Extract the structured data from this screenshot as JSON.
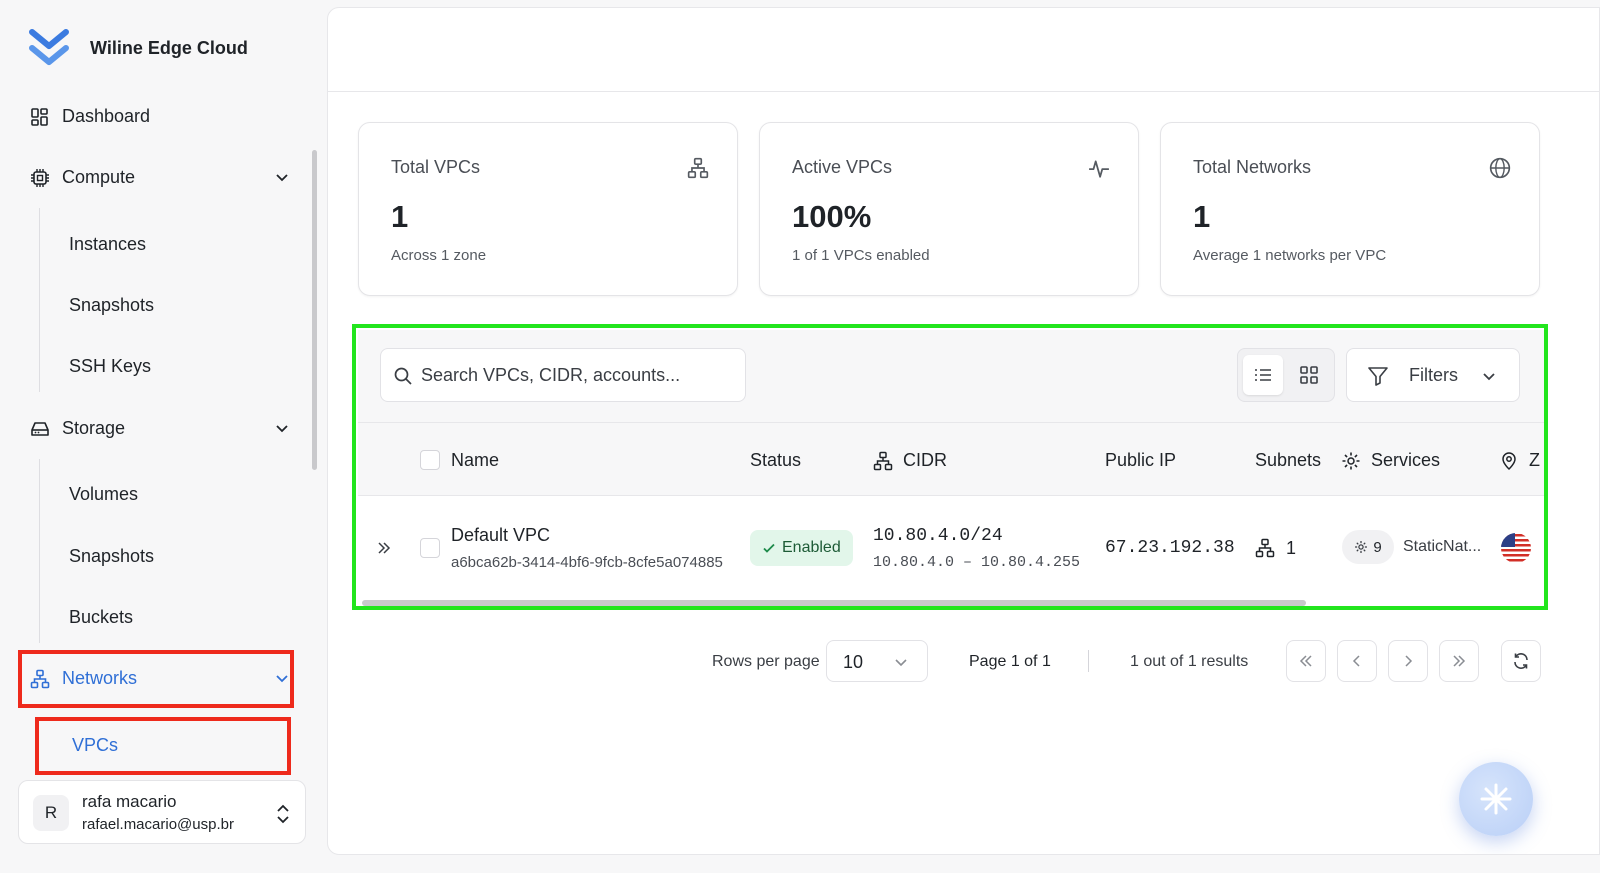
{
  "brand": {
    "name": "Wiline Edge Cloud"
  },
  "sidebar": {
    "dashboard": "Dashboard",
    "compute": {
      "label": "Compute",
      "items": [
        "Instances",
        "Snapshots",
        "SSH Keys"
      ]
    },
    "storage": {
      "label": "Storage",
      "items": [
        "Volumes",
        "Snapshots",
        "Buckets"
      ]
    },
    "networks": {
      "label": "Networks",
      "items": [
        "VPCs"
      ]
    }
  },
  "user": {
    "initial": "R",
    "name": "rafa macario",
    "email": "rafael.macario@usp.br"
  },
  "stats": [
    {
      "title": "Total VPCs",
      "value": "1",
      "sub": "Across 1 zone",
      "icon": "network-icon"
    },
    {
      "title": "Active VPCs",
      "value": "100%",
      "sub": "1 of 1 VPCs enabled",
      "icon": "activity-icon"
    },
    {
      "title": "Total Networks",
      "value": "1",
      "sub": "Average 1 networks per VPC",
      "icon": "globe-icon"
    }
  ],
  "toolbar": {
    "search_placeholder": "Search VPCs, CIDR, accounts...",
    "filters_label": "Filters"
  },
  "table": {
    "columns": {
      "name": "Name",
      "status": "Status",
      "cidr": "CIDR",
      "public_ip": "Public IP",
      "subnets": "Subnets",
      "services": "Services",
      "zone": "Z"
    },
    "rows": [
      {
        "name": "Default VPC",
        "id": "a6bca62b-3414-4bf6-9fcb-8cfe5a074885",
        "status": "Enabled",
        "cidr": "10.80.4.0/24",
        "cidr_range": "10.80.4.0 – 10.80.4.255",
        "public_ip": "67.23.192.38",
        "subnets": "1",
        "services_count": "9",
        "services_text": "StaticNat...",
        "zone_flag": "us-flag-icon"
      }
    ]
  },
  "pagination": {
    "rows_per_page_label": "Rows per page",
    "rows_per_page": "10",
    "page_label": "Page 1 of 1",
    "results_label": "1 out of 1 results"
  },
  "colors": {
    "accent": "#2f6fd6",
    "highlight_red": "#ee2a1c",
    "highlight_green": "#22e51d",
    "enabled_bg": "#e2f6ea"
  }
}
